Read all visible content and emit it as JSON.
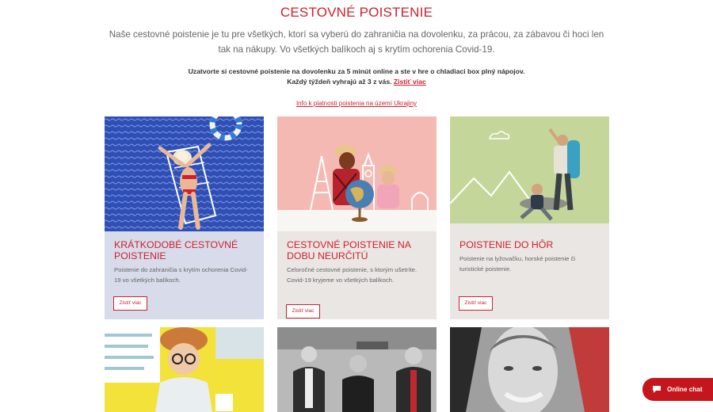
{
  "header": {
    "title": "CESTOVNÉ POISTENIE",
    "intro": "Naše cestovné poistenie je tu pre všetkých, ktorí sa vyberú do zahraničia na dovolenku, za prácou, za zábavou či hoci len tak na nákupy. Vo všetkých balíkoch aj s krytím ochorenia Covid-19."
  },
  "promo": {
    "line1": "Uzatvorte si cestovné poistenie na dovolenku za 5 minút online  a ste v hre o chladiaci box plný nápojov.",
    "line2": "Každý týždeň vyhrajú až 3 z vás.",
    "link": "Zistiť viac"
  },
  "ukraine_link": "Info k platnosti poistenia na území Ukrajiny",
  "cards": [
    {
      "title": "KRÁTKODOBÉ CESTOVNÉ POISTENIE",
      "text": "Poistenie do zahraničia s krytím ochorenia Covid-19 vo všetkých balíkoch.",
      "button": "Zistiť viac"
    },
    {
      "title": "CESTOVNÉ POISTENIE NA DOBU NEURČITÚ",
      "text": "Celoročné cestovné poistenie, s ktorým ušetríte. Covid-19 kryjeme vo všetkých balíkoch.",
      "button": "Zistiť viac"
    },
    {
      "title": "POISTENIE DO HÔR",
      "text": "Poistenie na lyžovačku, horské poistenie či turistické poistenie.",
      "button": "Zistiť viac"
    }
  ],
  "chat": {
    "label": "Online chat",
    "color": "#c4161c"
  },
  "colors": {
    "accent": "#d0202e",
    "card1_bg": "#d7dbea",
    "card2_bg": "#e9e6e3",
    "card3_bg": "#e9e6e3"
  },
  "icons": [
    "chat-bubble-icon"
  ]
}
